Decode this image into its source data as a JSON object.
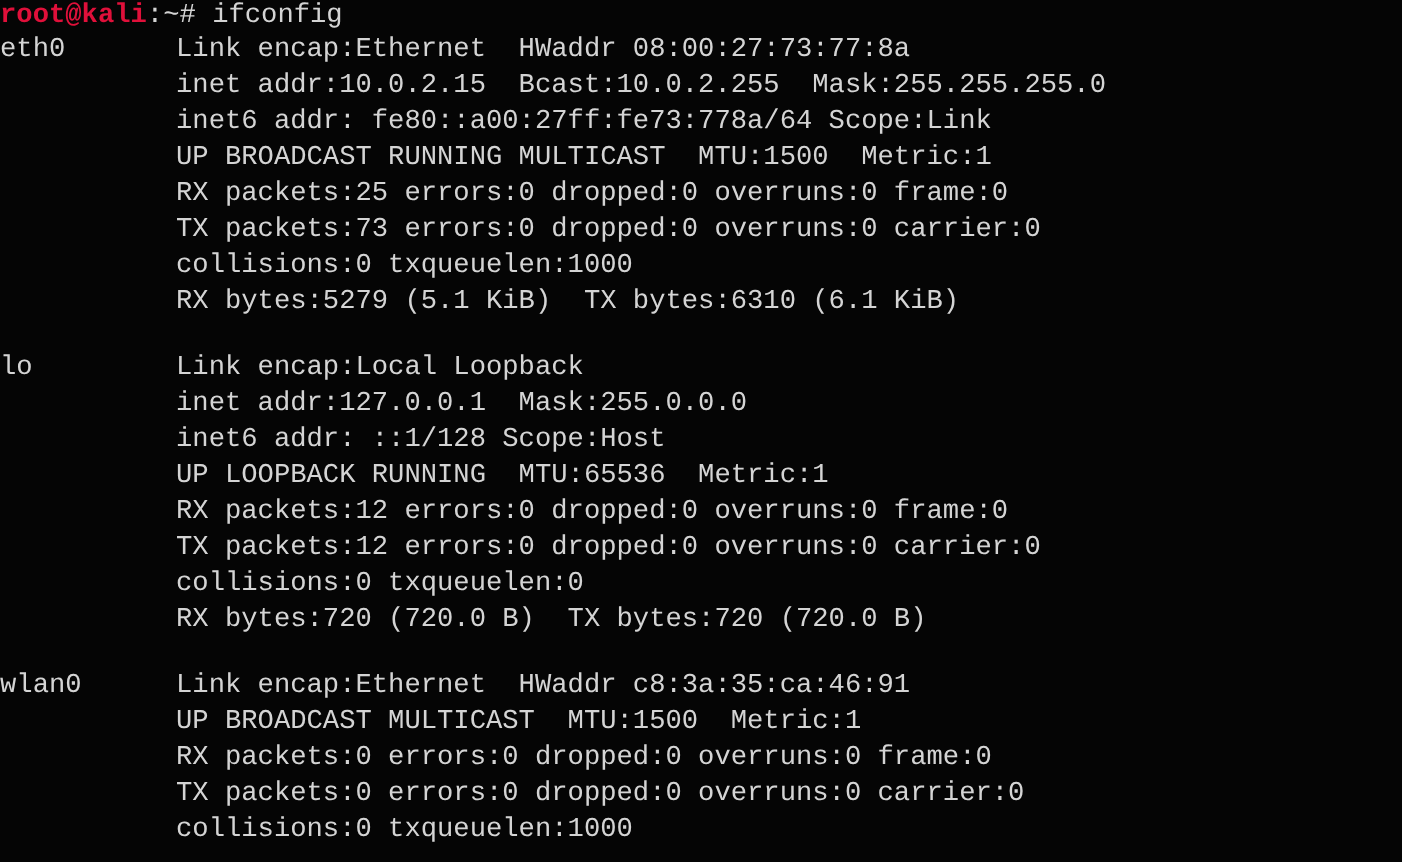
{
  "prompt": {
    "user_host": "root@kali",
    "path": ":~# ",
    "command": "ifconfig"
  },
  "interfaces": [
    {
      "name": "eth0",
      "lines": [
        "Link encap:Ethernet  HWaddr 08:00:27:73:77:8a",
        "inet addr:10.0.2.15  Bcast:10.0.2.255  Mask:255.255.255.0",
        "inet6 addr: fe80::a00:27ff:fe73:778a/64 Scope:Link",
        "UP BROADCAST RUNNING MULTICAST  MTU:1500  Metric:1",
        "RX packets:25 errors:0 dropped:0 overruns:0 frame:0",
        "TX packets:73 errors:0 dropped:0 overruns:0 carrier:0",
        "collisions:0 txqueuelen:1000",
        "RX bytes:5279 (5.1 KiB)  TX bytes:6310 (6.1 KiB)"
      ]
    },
    {
      "name": "lo",
      "lines": [
        "Link encap:Local Loopback",
        "inet addr:127.0.0.1  Mask:255.0.0.0",
        "inet6 addr: ::1/128 Scope:Host",
        "UP LOOPBACK RUNNING  MTU:65536  Metric:1",
        "RX packets:12 errors:0 dropped:0 overruns:0 frame:0",
        "TX packets:12 errors:0 dropped:0 overruns:0 carrier:0",
        "collisions:0 txqueuelen:0",
        "RX bytes:720 (720.0 B)  TX bytes:720 (720.0 B)"
      ]
    },
    {
      "name": "wlan0",
      "lines": [
        "Link encap:Ethernet  HWaddr c8:3a:35:ca:46:91",
        "UP BROADCAST MULTICAST  MTU:1500  Metric:1",
        "RX packets:0 errors:0 dropped:0 overruns:0 frame:0",
        "TX packets:0 errors:0 dropped:0 overruns:0 carrier:0",
        "collisions:0 txqueuelen:1000"
      ]
    }
  ]
}
